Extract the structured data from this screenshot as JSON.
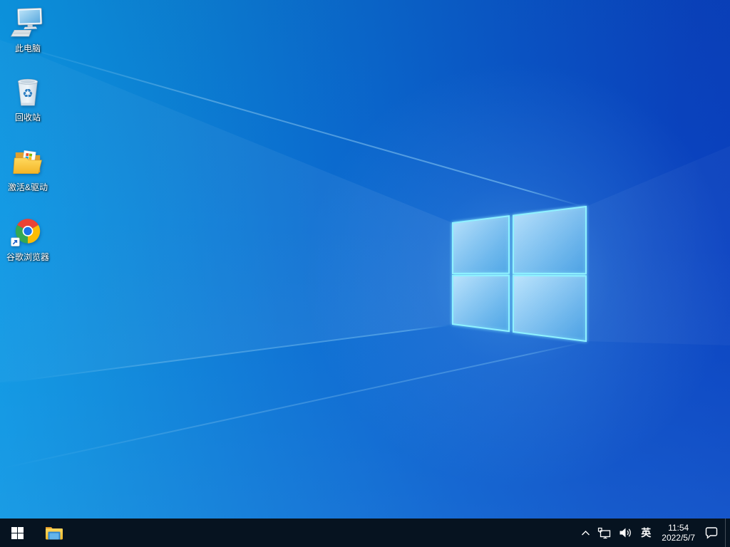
{
  "desktop": {
    "icons": [
      {
        "name": "this-pc",
        "label": "此电脑"
      },
      {
        "name": "recycle-bin",
        "label": "回收站"
      },
      {
        "name": "drivers-folder",
        "label": "激活&驱动"
      },
      {
        "name": "chrome",
        "label": "谷歌浏览器"
      }
    ]
  },
  "taskbar": {
    "tray": {
      "language_indicator": "英",
      "time": "11:54",
      "date": "2022/5/7"
    },
    "icons": [
      "start",
      "file-explorer",
      "hidden-icons-chevron",
      "network",
      "volume",
      "action-center",
      "show-desktop"
    ]
  },
  "colors": {
    "wallpaper_left": "#0d9ce6",
    "wallpaper_right": "#0a40c0",
    "logo_pane_stroke": "#8ff2ff",
    "taskbar_bg": "#061320",
    "text": "#ffffff"
  }
}
